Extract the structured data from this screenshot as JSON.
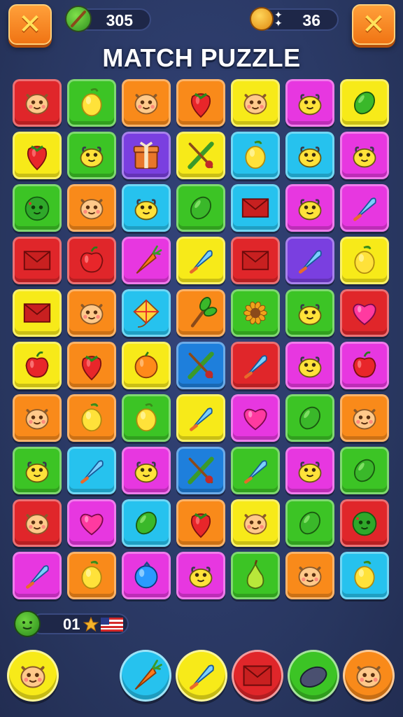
{
  "header": {
    "title": "MATCH PUZZLE",
    "moves": "305",
    "coins": "36",
    "close_left_icon": "x-icon",
    "close_right_icon": "x-icon"
  },
  "colors": {
    "red": "#e0262a",
    "green": "#3cc425",
    "orange": "#f98a1a",
    "yellow": "#f7ea19",
    "magenta": "#e737e0",
    "cyan": "#26c2ee",
    "purple": "#7a3fe0",
    "blue": "#1e7fdc"
  },
  "board": {
    "rows": [
      [
        [
          "red",
          "monster"
        ],
        [
          "green",
          "lemon"
        ],
        [
          "orange",
          "monster"
        ],
        [
          "orange",
          "strawberry"
        ],
        [
          "yellow",
          "monster"
        ],
        [
          "magenta",
          "blob"
        ],
        [
          "yellow",
          "lime"
        ]
      ],
      [
        [
          "yellow",
          "strawberry"
        ],
        [
          "green",
          "blob"
        ],
        [
          "purple",
          "gift"
        ],
        [
          "yellow",
          "sword"
        ],
        [
          "cyan",
          "lemon"
        ],
        [
          "cyan",
          "blob"
        ],
        [
          "magenta",
          "blob"
        ]
      ],
      [
        [
          "green",
          "melon"
        ],
        [
          "orange",
          "monster"
        ],
        [
          "cyan",
          "blob"
        ],
        [
          "green",
          "lime"
        ],
        [
          "cyan",
          "envelope"
        ],
        [
          "magenta",
          "blob"
        ],
        [
          "magenta",
          "cone"
        ]
      ],
      [
        [
          "red",
          "envelope"
        ],
        [
          "red",
          "apple"
        ],
        [
          "magenta",
          "carrot"
        ],
        [
          "yellow",
          "cone"
        ],
        [
          "red",
          "envelope"
        ],
        [
          "purple",
          "cone"
        ],
        [
          "yellow",
          "lemon"
        ]
      ],
      [
        [
          "yellow",
          "envelope"
        ],
        [
          "orange",
          "monster"
        ],
        [
          "cyan",
          "kite"
        ],
        [
          "orange",
          "plant"
        ],
        [
          "green",
          "flower"
        ],
        [
          "green",
          "blob"
        ],
        [
          "red",
          "heart"
        ]
      ],
      [
        [
          "yellow",
          "apple"
        ],
        [
          "orange",
          "strawberry"
        ],
        [
          "yellow",
          "orange"
        ],
        [
          "blue",
          "sword"
        ],
        [
          "red",
          "cone"
        ],
        [
          "magenta",
          "blob"
        ],
        [
          "magenta",
          "apple"
        ]
      ],
      [
        [
          "orange",
          "monster"
        ],
        [
          "orange",
          "lemon"
        ],
        [
          "green",
          "lemon"
        ],
        [
          "yellow",
          "cone"
        ],
        [
          "magenta",
          "heart"
        ],
        [
          "green",
          "lime"
        ],
        [
          "orange",
          "monster"
        ]
      ],
      [
        [
          "green",
          "blob"
        ],
        [
          "cyan",
          "cone"
        ],
        [
          "magenta",
          "blob"
        ],
        [
          "blue",
          "sword"
        ],
        [
          "green",
          "cone"
        ],
        [
          "magenta",
          "blob"
        ],
        [
          "green",
          "lime"
        ]
      ],
      [
        [
          "red",
          "monster"
        ],
        [
          "magenta",
          "heart"
        ],
        [
          "cyan",
          "lime"
        ],
        [
          "orange",
          "strawberry"
        ],
        [
          "yellow",
          "monster"
        ],
        [
          "green",
          "lime"
        ],
        [
          "red",
          "melon"
        ]
      ],
      [
        [
          "magenta",
          "cone"
        ],
        [
          "orange",
          "lemon"
        ],
        [
          "magenta",
          "berry"
        ],
        [
          "magenta",
          "blob"
        ],
        [
          "green",
          "pear"
        ],
        [
          "orange",
          "monster"
        ],
        [
          "cyan",
          "lemon"
        ]
      ]
    ]
  },
  "counter": {
    "value": "01",
    "avatar_icon": "melon-icon",
    "star_icon": "star-icon",
    "flag_icon": "flag-icon"
  },
  "powerups": [
    {
      "color": "yellow",
      "item": "monster"
    },
    {
      "color": "cyan",
      "item": "carrot"
    },
    {
      "color": "yellow",
      "item": "cone"
    },
    {
      "color": "red",
      "item": "envelope"
    },
    {
      "color": "green",
      "item": "stone"
    },
    {
      "color": "orange",
      "item": "monster"
    }
  ]
}
